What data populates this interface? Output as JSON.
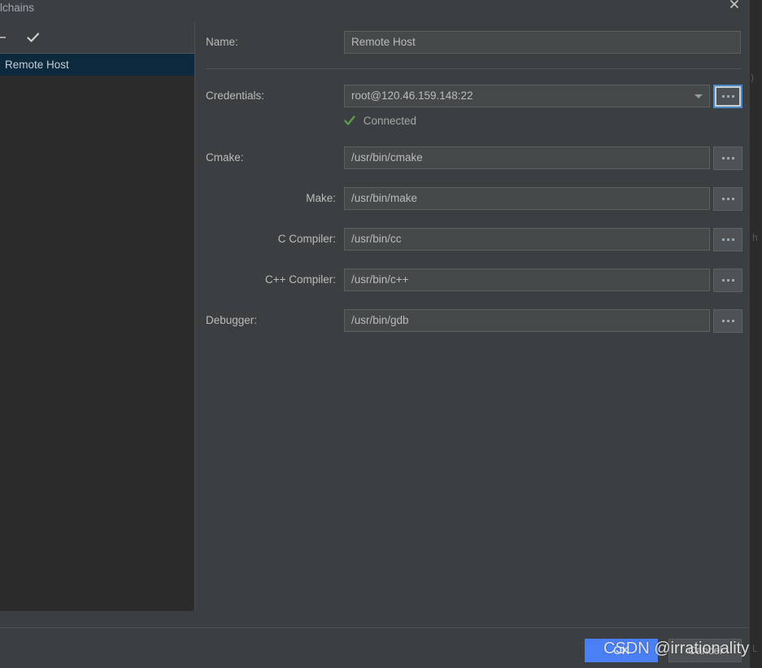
{
  "dialog": {
    "title": "lchains",
    "close_icon": "close-x-icon"
  },
  "left_panel": {
    "toolbar": {
      "remove_icon": "minus-icon",
      "apply_icon": "checkmark-icon"
    },
    "items": [
      {
        "label": "Remote Host",
        "selected": true
      }
    ]
  },
  "form": {
    "name": {
      "label": "Name:",
      "value": "Remote Host"
    },
    "credentials": {
      "label": "Credentials:",
      "value": "root@120.46.159.148:22",
      "dropdown_icon": "chevron-down-icon",
      "browse_label": "...",
      "status": {
        "text": "Connected",
        "icon": "check-icon",
        "color": "#5d9e4f"
      }
    },
    "cmake": {
      "label": "Cmake:",
      "value": "/usr/bin/cmake",
      "browse_label": "..."
    },
    "make": {
      "label": "Make:",
      "value": "/usr/bin/make",
      "browse_label": "..."
    },
    "c_compiler": {
      "label": "C Compiler:",
      "value": "/usr/bin/cc",
      "browse_label": "..."
    },
    "cpp_compiler": {
      "label": "C++ Compiler:",
      "value": "/usr/bin/c++",
      "browse_label": "..."
    },
    "debugger": {
      "label": "Debugger:",
      "value": "/usr/bin/gdb",
      "browse_label": "..."
    }
  },
  "buttons": {
    "ok": "OK",
    "cancel": "Cancel"
  },
  "watermark": {
    "text": "CSDN @irrationality"
  },
  "background": {
    "ghost_chars": [
      ")",
      "h",
      "L"
    ]
  },
  "colors": {
    "accent_blue": "#4a7ff5",
    "selection_blue": "#0d293e",
    "focus_ring": "#4a88c7",
    "status_green": "#5d9e4f",
    "panel_bg": "#3c3f41",
    "list_bg": "#2b2b2b",
    "field_bg": "#45494a"
  }
}
